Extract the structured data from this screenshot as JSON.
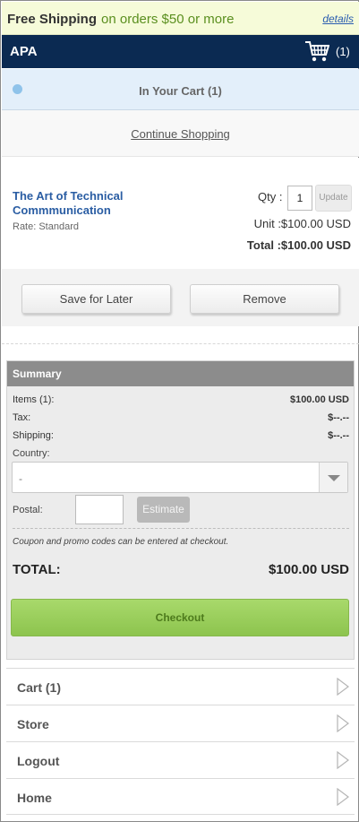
{
  "promo": {
    "bold": "Free Shipping",
    "rest": "on orders $50 or more",
    "details": "details"
  },
  "header": {
    "brand": "APA",
    "cart_count": "(1)",
    "cart_icon": "shopping-cart-icon"
  },
  "incart": {
    "label": "In Your Cart (1)"
  },
  "continue": {
    "label": "Continue Shopping"
  },
  "item": {
    "title": "The Art of Technical Commmunication",
    "rate": "Rate: Standard",
    "qty_label": "Qty :",
    "qty_value": "1",
    "update_label": "Update",
    "unit": "Unit :$100.00 USD",
    "total": "Total :$100.00 USD"
  },
  "actions": {
    "save_label": "Save for Later",
    "remove_label": "Remove"
  },
  "summary": {
    "title": "Summary",
    "rows": [
      {
        "label": "Items (1):",
        "value": "$100.00 USD"
      },
      {
        "label": "Tax:",
        "value": "$--.--"
      },
      {
        "label": "Shipping:",
        "value": "$--.--"
      }
    ],
    "country_label": "Country:",
    "country_value": "-",
    "postal_label": "Postal:",
    "postal_value": "",
    "estimate_label": "Estimate",
    "coupon_note": "Coupon and promo codes can be entered at checkout.",
    "total_label": "TOTAL:",
    "total_value": "$100.00 USD",
    "checkout_label": "Checkout"
  },
  "nav": [
    {
      "label": "Cart (1)"
    },
    {
      "label": "Store"
    },
    {
      "label": "Logout"
    },
    {
      "label": "Home"
    }
  ],
  "colors": {
    "header_bg": "#0b2a52",
    "promo_bg": "#f6fbd9",
    "promo_accent": "#5a8f1f",
    "link": "#2a5da3",
    "checkout_green": "#8dc44e"
  }
}
